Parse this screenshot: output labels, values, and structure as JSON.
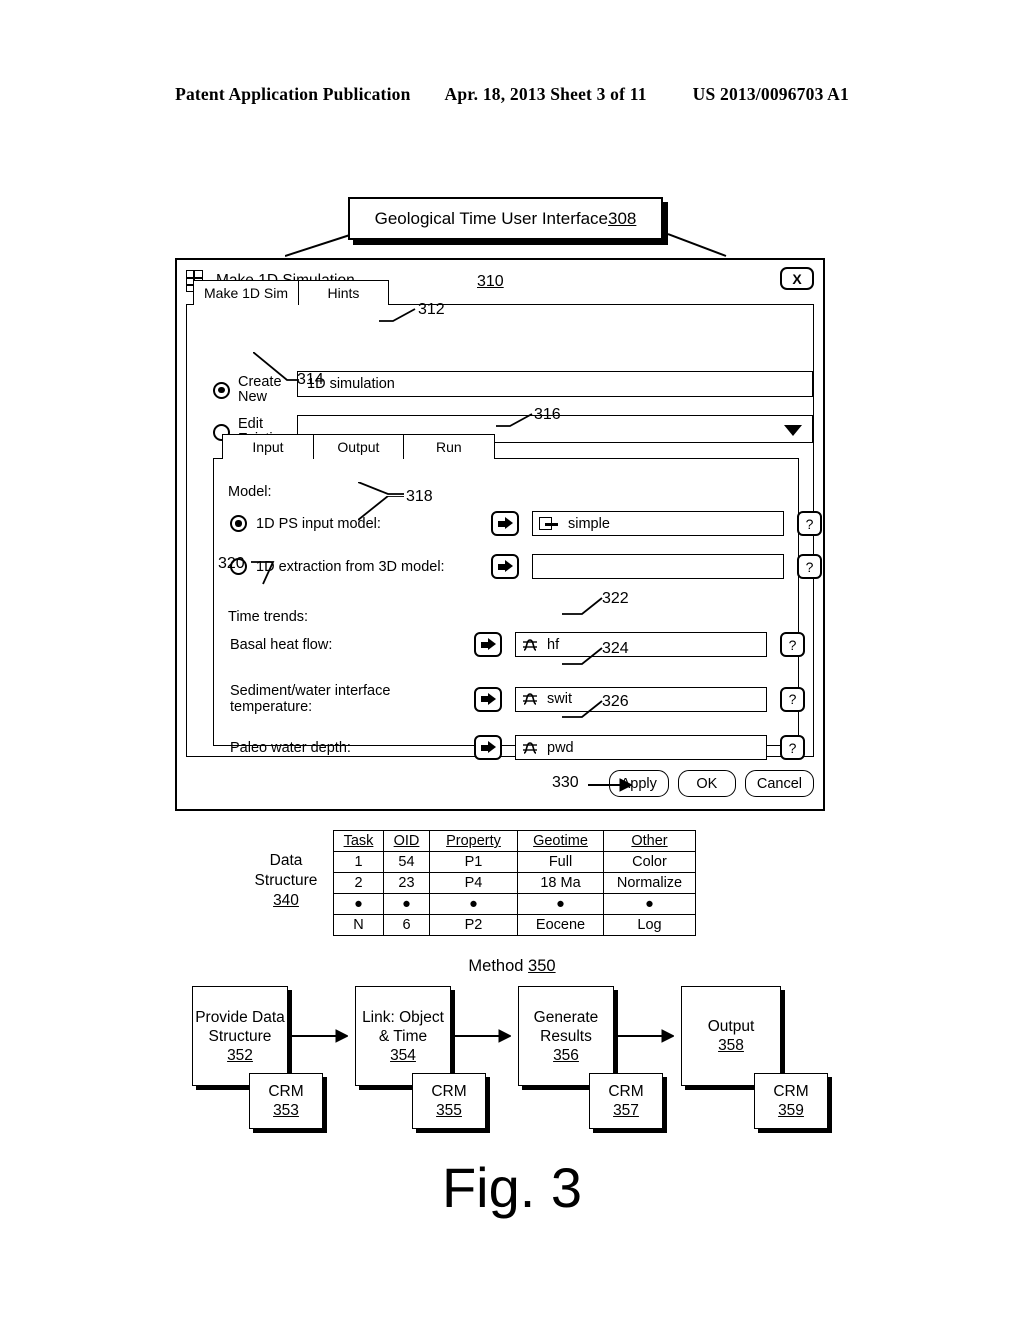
{
  "patent_header": {
    "publication": "Patent Application Publication",
    "date_sheet": "Apr. 18, 2013  Sheet 3 of 11",
    "number": "US 2013/0096703 A1"
  },
  "title_callout": {
    "text": "Geological Time User Interface ",
    "ref": "308"
  },
  "dialog": {
    "window_title": "Make 1D Simulation",
    "window_ref": "310",
    "close_label": "X",
    "app_icon": "window-grid-icon",
    "outer_tabs": [
      {
        "label": "Make 1D Sim",
        "selected": true
      },
      {
        "label": "Hints",
        "selected": false
      }
    ],
    "outer_tabs_ref": "312",
    "mode": {
      "create_new_label": "Create New",
      "create_new_selected": true,
      "edit_existing_label": "Edit Existing",
      "edit_existing_selected": false,
      "name_value": "1D simulation",
      "existing_value": "",
      "ref": "314"
    },
    "inner_tabs": [
      {
        "label": "Input",
        "selected": true
      },
      {
        "label": "Output",
        "selected": false
      },
      {
        "label": "Run",
        "selected": false
      }
    ],
    "inner_tabs_ref": "316",
    "model": {
      "section_label": "Model:",
      "ps_input_label": "1D PS input model:",
      "ps_input_selected": true,
      "ps_input_value": "simple",
      "ps_input_icon": "model-node-icon",
      "extraction_label": "1D extraction from 3D model:",
      "extraction_selected": false,
      "extraction_value": "",
      "ref": "318",
      "help_label": "?"
    },
    "time_trends": {
      "section_label": "Time trends:",
      "ref": "320",
      "rows": [
        {
          "label": "Basal heat flow:",
          "value": "hf",
          "ref": "322",
          "icon": "trend-curve-icon"
        },
        {
          "label": "Sediment/water interface temperature:",
          "value": "swit",
          "ref": "324",
          "icon": "trend-curve-icon"
        },
        {
          "label": "Paleo water depth:",
          "value": "pwd",
          "ref": "326",
          "icon": "trend-curve-icon"
        }
      ]
    },
    "buttons": {
      "ref": "330",
      "apply": "Apply",
      "ok": "OK",
      "cancel": "Cancel"
    }
  },
  "data_structure": {
    "label_line1": "Data",
    "label_line2": "Structure",
    "ref": "340",
    "headers": [
      "Task",
      "OID",
      "Property",
      "Geotime",
      "Other"
    ],
    "rows": [
      [
        "1",
        "54",
        "P1",
        "Full",
        "Color"
      ],
      [
        "2",
        "23",
        "P4",
        "18 Ma",
        "Normalize"
      ],
      [
        "●",
        "●",
        "●",
        "●",
        "●"
      ],
      [
        "N",
        "6",
        "P2",
        "Eocene",
        "Log"
      ]
    ]
  },
  "method": {
    "title": "Method ",
    "title_ref": "350",
    "steps": [
      {
        "label": "Provide Data Structure",
        "ref": "352",
        "crm_label": "CRM",
        "crm_ref": "353"
      },
      {
        "label": "Link: Object & Time",
        "ref": "354",
        "crm_label": "CRM",
        "crm_ref": "355"
      },
      {
        "label": "Generate Results",
        "ref": "356",
        "crm_label": "CRM",
        "crm_ref": "357"
      },
      {
        "label": "Output",
        "ref": "358",
        "crm_label": "CRM",
        "crm_ref": "359"
      }
    ]
  },
  "figure_caption": "Fig. 3"
}
